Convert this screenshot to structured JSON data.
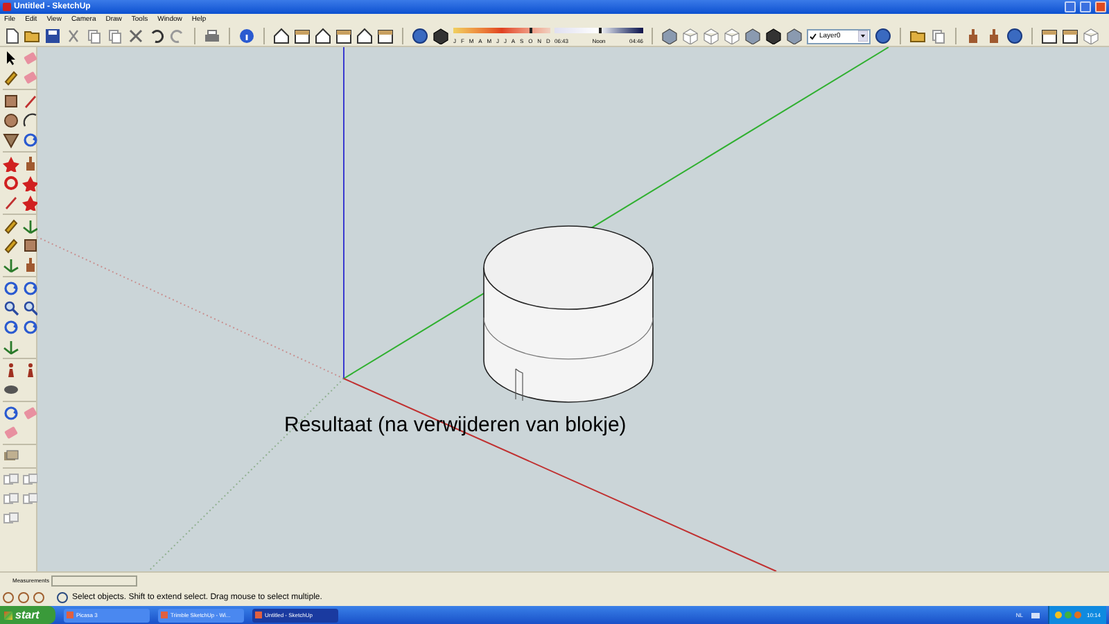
{
  "window": {
    "title": "Untitled - SketchUp"
  },
  "menu": [
    "File",
    "Edit",
    "View",
    "Camera",
    "Draw",
    "Tools",
    "Window",
    "Help"
  ],
  "shadow_settings": {
    "month_slider": {
      "level": 0.78
    },
    "time_slider": {
      "level": 0.5
    },
    "months": [
      "J",
      "F",
      "M",
      "A",
      "M",
      "J",
      "J",
      "A",
      "S",
      "O",
      "N",
      "D"
    ],
    "time_start": "06:43",
    "time_mid": "Noon",
    "time_end": "04:46"
  },
  "layer": {
    "value": "Layer0",
    "checked": true
  },
  "viewport": {
    "caption": "Resultaat (na verwijderen van blokje)"
  },
  "measurements": {
    "label": "Measurements"
  },
  "status_bar": {
    "text": "Select objects. Shift to extend select. Drag mouse to select multiple."
  },
  "taskbar": {
    "start": "start",
    "tasks": [
      {
        "label": "Picasa 3",
        "selected": false
      },
      {
        "label": "Trimble SketchUp - Wi...",
        "selected": false
      },
      {
        "label": "Untitled - SketchUp",
        "selected": true
      }
    ],
    "language": "NL",
    "clock": "10:14"
  }
}
